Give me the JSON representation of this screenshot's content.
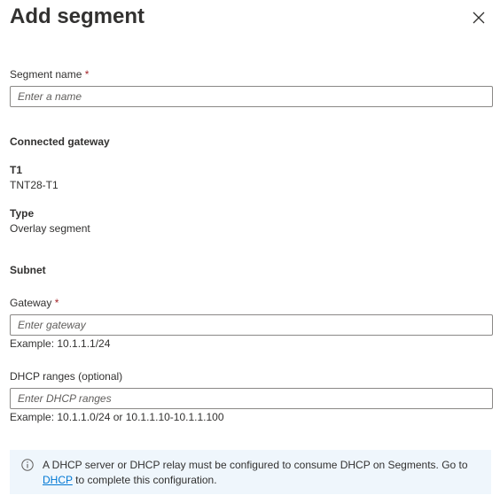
{
  "panel": {
    "title": "Add segment",
    "close_label": "Close"
  },
  "segment_name": {
    "label": "Segment name",
    "required_mark": "*",
    "placeholder": "Enter a name",
    "value": ""
  },
  "connected_gateway": {
    "heading": "Connected gateway",
    "t1_label": "T1",
    "t1_value": "TNT28-T1",
    "type_label": "Type",
    "type_value": "Overlay segment"
  },
  "subnet": {
    "heading": "Subnet",
    "gateway": {
      "label": "Gateway",
      "required_mark": "*",
      "placeholder": "Enter gateway",
      "value": "",
      "example": "Example: 10.1.1.1/24"
    },
    "dhcp_ranges": {
      "label": "DHCP ranges (optional)",
      "placeholder": "Enter DHCP ranges",
      "value": "",
      "example": "Example: 10.1.1.0/24 or 10.1.1.10-10.1.1.100"
    }
  },
  "info": {
    "text_before": "A DHCP server or DHCP relay must be configured to consume DHCP on Segments. Go to ",
    "link_text": "DHCP",
    "text_after": " to complete this configuration.",
    "icon": "info-icon"
  },
  "colors": {
    "accent": "#0078d4",
    "required": "#a4262c",
    "info_background": "#eff6fc"
  }
}
